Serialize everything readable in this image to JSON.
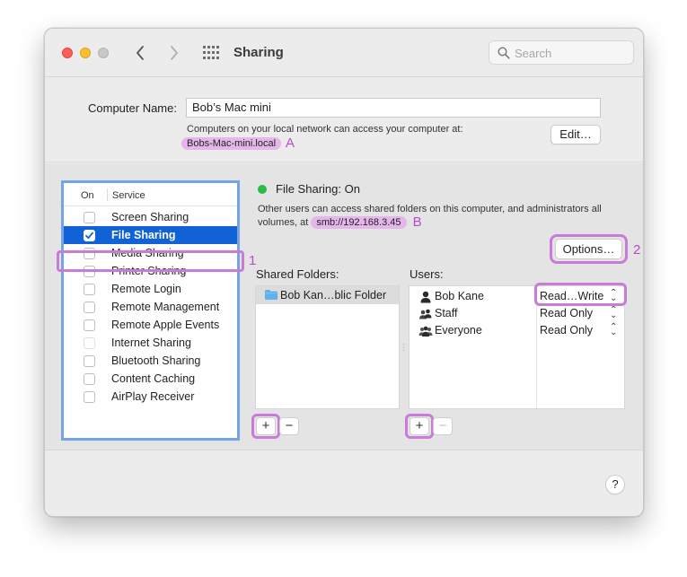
{
  "window": {
    "title": "Sharing",
    "search_placeholder": "Search",
    "icons": {
      "back": "chevron-left-icon",
      "forward": "chevron-right-icon",
      "grid": "show-all-grid-icon",
      "search": "magnifying-glass-icon"
    }
  },
  "computer_name": {
    "label": "Computer Name:",
    "value": "Bob’s Mac mini",
    "help_text": "Computers on your local network can access your computer at:",
    "hostname": "Bobs-Mac-mini.local",
    "edit_label": "Edit…"
  },
  "services": {
    "header_on": "On",
    "header_service": "Service",
    "items": [
      {
        "label": "Screen Sharing",
        "checked": false,
        "selected": false
      },
      {
        "label": "File Sharing",
        "checked": true,
        "selected": true
      },
      {
        "label": "Media Sharing",
        "checked": false,
        "selected": false
      },
      {
        "label": "Printer Sharing",
        "checked": false,
        "selected": false
      },
      {
        "label": "Remote Login",
        "checked": false,
        "selected": false
      },
      {
        "label": "Remote Management",
        "checked": false,
        "selected": false
      },
      {
        "label": "Remote Apple Events",
        "checked": false,
        "selected": false
      },
      {
        "label": "Internet Sharing",
        "checked": false,
        "selected": false,
        "disabled": true
      },
      {
        "label": "Bluetooth Sharing",
        "checked": false,
        "selected": false
      },
      {
        "label": "Content Caching",
        "checked": false,
        "selected": false
      },
      {
        "label": "AirPlay Receiver",
        "checked": false,
        "selected": false
      }
    ]
  },
  "detail": {
    "status": "File Sharing: On",
    "status_color": "#2dbb40",
    "description_pre": "Other users can access shared folders on this computer, and administrators all volumes, at ",
    "address": "smb://192.168.3.45",
    "options_label": "Options…",
    "shared_folders_label": "Shared Folders:",
    "users_label": "Users:",
    "shared_folders": [
      {
        "label": "Bob Kan…blic Folder",
        "icon": "folder-icon"
      }
    ],
    "users": [
      {
        "label": "Bob Kane",
        "permission": "Read…Write",
        "icon": "single-user-icon"
      },
      {
        "label": "Staff",
        "permission": "Read Only",
        "icon": "group-icon"
      },
      {
        "label": "Everyone",
        "permission": "Read Only",
        "icon": "everyone-icon"
      }
    ],
    "plus": "+",
    "minus": "−"
  },
  "help_label": "?",
  "annotations": {
    "A": "A",
    "B": "B",
    "one": "1",
    "two": "2",
    "color": "#c87bd9"
  }
}
